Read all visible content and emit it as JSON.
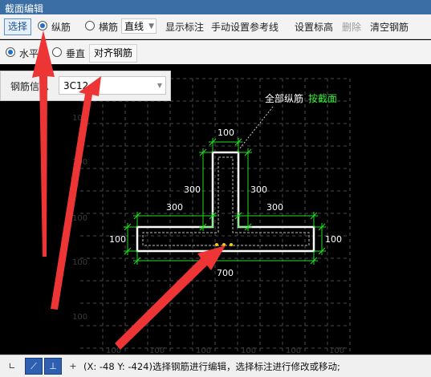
{
  "title": "截面编辑",
  "toolbar": {
    "select_label": "选择",
    "longitudinal_label": "纵筋",
    "transverse_label": "横筋",
    "line_type_value": "直线",
    "show_label": "显示标注",
    "manual_ref_label": "手动设置参考线",
    "set_elevation_label": "设置标高",
    "delete_label": "删除",
    "clear_rebar_label": "清空钢筋"
  },
  "toolbar2": {
    "horizontal_label": "水平",
    "vertical_label": "垂直",
    "align_label": "对齐钢筋"
  },
  "rebar_info": {
    "label": "钢筋信息",
    "value": "3C12"
  },
  "drawing": {
    "annotation_all": "全部纵筋",
    "annotation_by_section": "按截面",
    "dims": {
      "top_width": "100",
      "left_height": "300",
      "right_height": "300",
      "left_width": "300",
      "right_width": "300",
      "left_thickness": "100",
      "right_thickness": "100",
      "bottom_total": "700"
    },
    "grid_label": "100",
    "colors": {
      "section_outline": "#ffffff",
      "dimension": "#22dd22",
      "annotation_green": "#33ee33",
      "arrow": "#ee3333",
      "grid": "#4a4a4a"
    }
  },
  "statusbar": {
    "coords": "(X: -48 Y: -424)选择钢筋进行编辑，选择标注进行修改或移动;"
  }
}
